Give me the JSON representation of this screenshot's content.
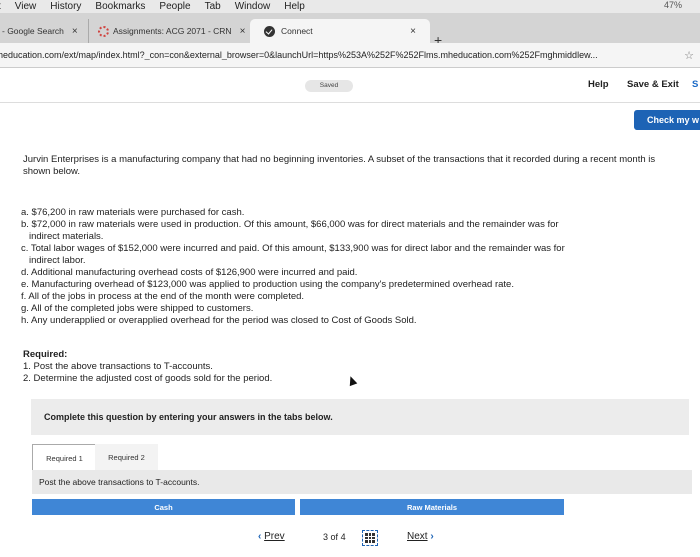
{
  "menubar": {
    "items": [
      "t",
      "View",
      "History",
      "Bookmarks",
      "People",
      "Tab",
      "Window",
      "Help"
    ],
    "right_text": "47%"
  },
  "browser_tabs": [
    {
      "label": "- Google Search",
      "close": "×"
    },
    {
      "label": "Assignments: ACG 2071 - CRN",
      "close": "×"
    },
    {
      "label": "Connect",
      "close": "×"
    }
  ],
  "new_tab": "+",
  "url": "heducation.com/ext/map/index.html?_con=con&external_browser=0&launchUrl=https%253A%252F%252Flms.mheducation.com%252Fmghmiddlew...",
  "app_header": {
    "saved": "Saved",
    "help": "Help",
    "save_exit": "Save & Exit",
    "submit_trunc": "S"
  },
  "check_button": "Check my w",
  "question": {
    "intro": "Jurvin Enterprises is a manufacturing company that had no beginning inventories. A subset of the transactions that it recorded during a recent month is shown below.",
    "items": [
      {
        "line1": "a. $76,200 in raw materials were purchased for cash.",
        "line2": ""
      },
      {
        "line1": "b. $72,000 in raw materials were used in production. Of this amount, $66,000 was for direct materials and the remainder was for",
        "line2": "indirect materials."
      },
      {
        "line1": "c. Total labor wages of $152,000 were incurred and paid. Of this amount, $133,900 was for direct labor and the remainder was for",
        "line2": "indirect labor."
      },
      {
        "line1": "d. Additional manufacturing overhead costs of $126,900 were incurred and paid.",
        "line2": ""
      },
      {
        "line1": "e. Manufacturing overhead of $123,000 was applied to production using the company's predetermined overhead rate.",
        "line2": ""
      },
      {
        "line1": "f. All of the jobs in process at the end of the month were completed.",
        "line2": ""
      },
      {
        "line1": "g. All of the completed jobs were shipped to customers.",
        "line2": ""
      },
      {
        "line1": "h. Any underapplied or overapplied overhead for the period was closed to Cost of Goods Sold.",
        "line2": ""
      }
    ],
    "required_heading": "Required:",
    "required_1": "1. Post the above transactions to T-accounts.",
    "required_2": "2. Determine the adjusted cost of goods sold for the period."
  },
  "complete_note": "Complete this question by entering your answers in the tabs below.",
  "req_tabs": [
    "Required 1",
    "Required 2"
  ],
  "post_instruction": "Post the above transactions to T-accounts.",
  "t_accounts": [
    "Cash",
    "Raw Materials"
  ],
  "pager": {
    "prev": "Prev",
    "current": "3",
    "of": "of",
    "total": "4",
    "next": "Next"
  }
}
